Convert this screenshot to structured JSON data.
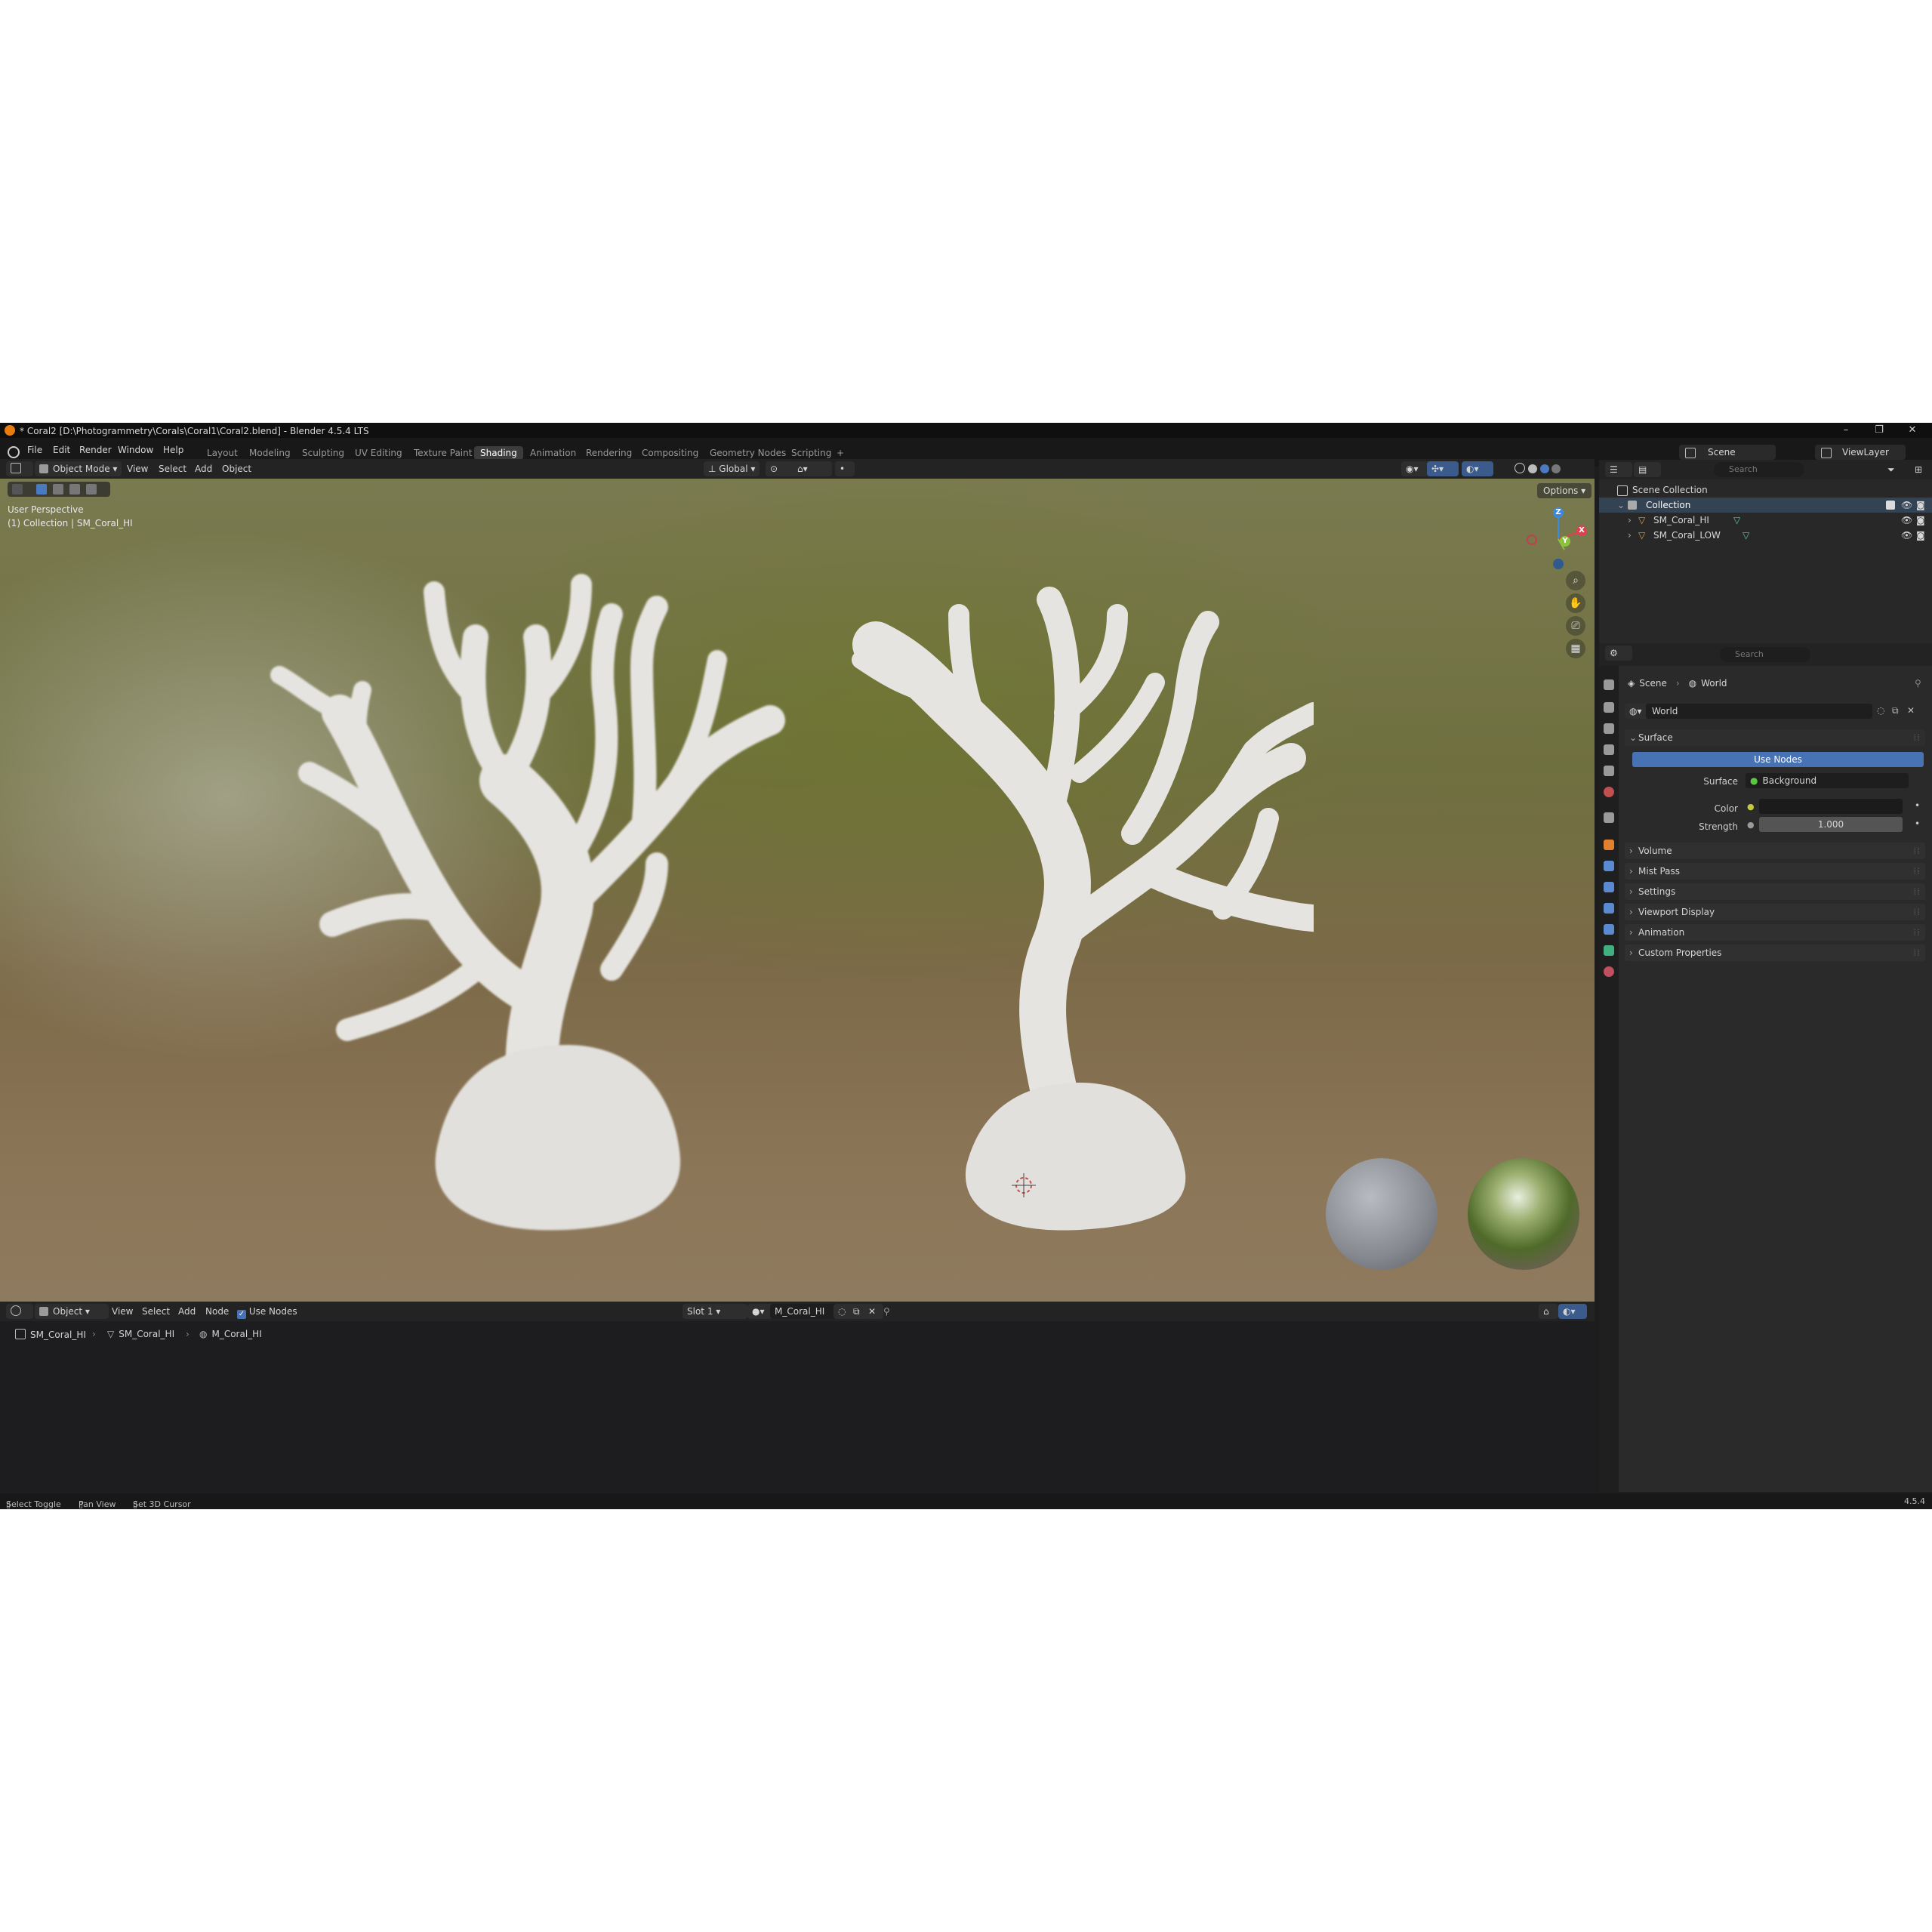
{
  "window": {
    "title": "* Coral2 [D:\\Photogrammetry\\Corals\\Coral1\\Coral2.blend] - Blender 4.5.4 LTS",
    "controls": [
      "–",
      "❐",
      "✕"
    ]
  },
  "menu": [
    "File",
    "Edit",
    "Render",
    "Window",
    "Help"
  ],
  "workspaces": [
    "Layout",
    "Modeling",
    "Sculpting",
    "UV Editing",
    "Texture Paint",
    "Shading",
    "Animation",
    "Rendering",
    "Compositing",
    "Geometry Nodes",
    "Scripting",
    "+"
  ],
  "active_workspace": "Shading",
  "scene_selector": {
    "scene": "Scene",
    "view_layer": "ViewLayer"
  },
  "viewport_header": {
    "mode": "Object Mode",
    "menus": [
      "View",
      "Select",
      "Add",
      "Object"
    ],
    "transform_orientation": "Global",
    "options": "Options"
  },
  "viewport": {
    "overlay_line1": "User Perspective",
    "overlay_line2": "(1) Collection | SM_Coral_HI",
    "gizmo_axes": {
      "x": "X",
      "y": "Y",
      "z": "Z"
    },
    "colors": {
      "x": "#e0404e",
      "y": "#8bc43c",
      "z": "#3a8be0"
    }
  },
  "shader_header": {
    "object_type": "Object",
    "menus": [
      "View",
      "Select",
      "Add",
      "Node"
    ],
    "use_nodes_label": "Use Nodes",
    "use_nodes_checked": true,
    "slot": "Slot 1",
    "material": "M_Coral_HI"
  },
  "shader_breadcrumb": [
    "SM_Coral_HI",
    "SM_Coral_HI",
    "M_Coral_HI"
  ],
  "outliner": {
    "search_placeholder": "Search",
    "root": "Scene Collection",
    "collection": "Collection",
    "objects": [
      "SM_Coral_HI",
      "SM_Coral_LOW"
    ]
  },
  "properties": {
    "search_placeholder": "Search",
    "breadcrumb": [
      "Scene",
      "World"
    ],
    "world_name": "World",
    "surface_panel": "Surface",
    "use_nodes_button": "Use Nodes",
    "surface_label": "Surface",
    "surface_value": "Background",
    "color_label": "Color",
    "strength_label": "Strength",
    "strength_value": "1.000",
    "panels": [
      "Volume",
      "Mist Pass",
      "Settings",
      "Viewport Display",
      "Animation",
      "Custom Properties"
    ],
    "accent": "#4772b3"
  },
  "status": {
    "items": [
      "Select Toggle",
      "Pan View",
      "Set 3D Cursor"
    ],
    "version": "4.5.4"
  }
}
